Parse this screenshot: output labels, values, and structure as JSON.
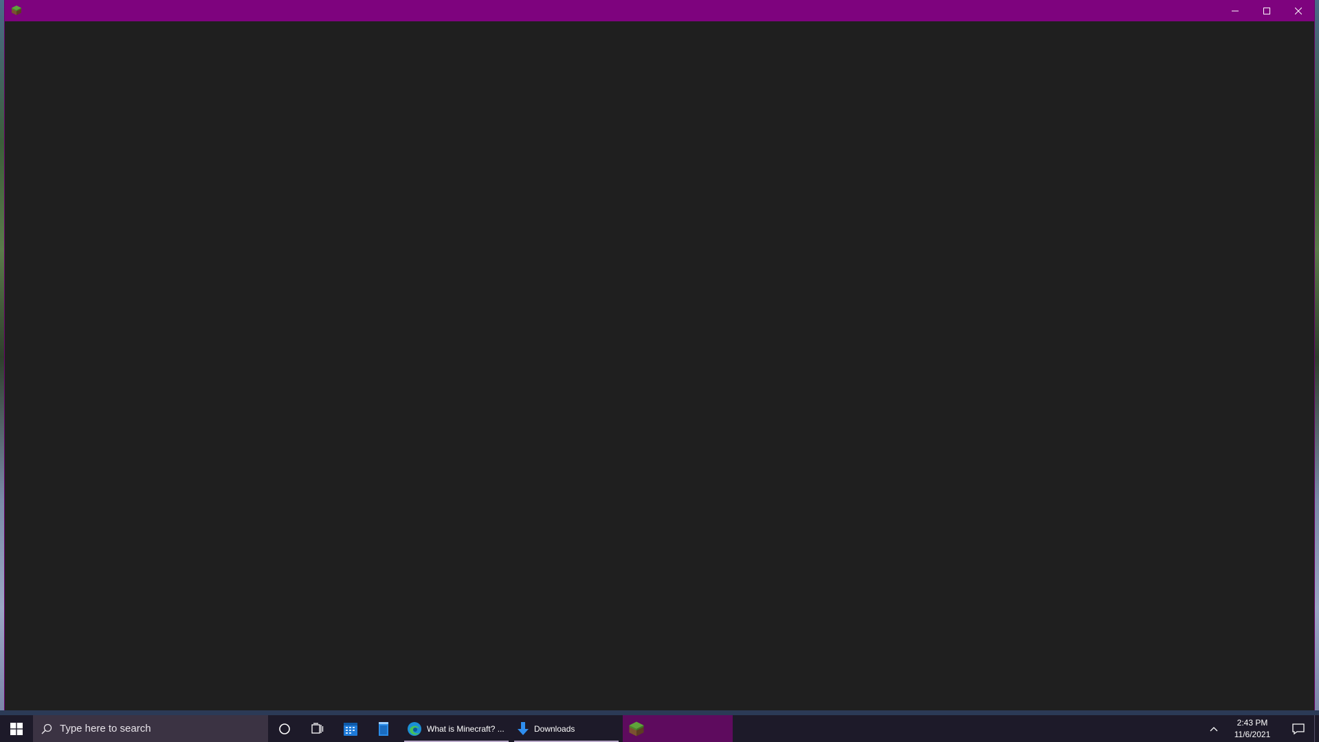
{
  "window": {
    "title": "",
    "controls": {
      "minimize": "minimize",
      "maximize": "maximize",
      "close": "close"
    },
    "colors": {
      "titlebar": "#7e037e",
      "client": "#1f1f1f"
    }
  },
  "taskbar": {
    "search_placeholder": "Type here to search",
    "pinned_icons": [
      "start-icon",
      "cortana-icon",
      "task-view-icon",
      "calendar-icon",
      "notepad-icon"
    ],
    "apps": [
      {
        "label": "What is Minecraft? ...",
        "icon": "edge-icon"
      },
      {
        "label": "Downloads",
        "icon": "download-arrow-icon"
      },
      {
        "label": "",
        "icon": "minecraft-grass-block-icon",
        "active": true
      }
    ],
    "clock": {
      "time": "2:43 PM",
      "date": "11/6/2021"
    },
    "colors": {
      "background": "#1d1a29",
      "search": "#3b3343",
      "active_app": "#5e0b5e"
    }
  }
}
